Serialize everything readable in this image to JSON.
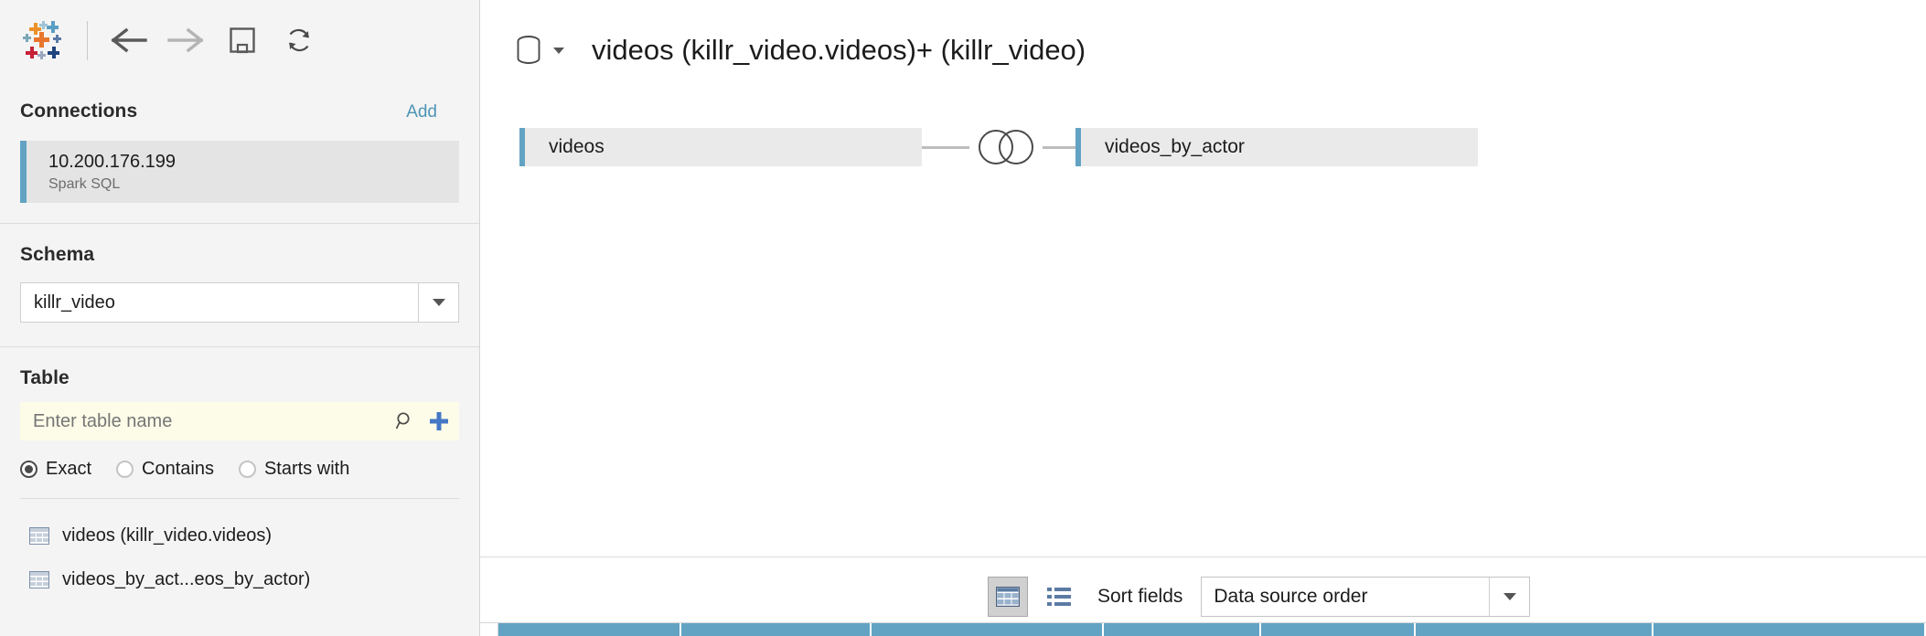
{
  "toolbar": {
    "logo_name": "tableau-logo",
    "back_label": "Back",
    "forward_label": "Forward",
    "save_label": "Save",
    "refresh_label": "Refresh Data Source"
  },
  "sidebar": {
    "connections": {
      "heading": "Connections",
      "add_label": "Add",
      "items": [
        {
          "name": "10.200.176.199",
          "type": "Spark SQL",
          "selected": true
        }
      ]
    },
    "schema": {
      "heading": "Schema",
      "selected": "killr_video"
    },
    "table": {
      "heading": "Table",
      "search_placeholder": "Enter table name",
      "search_value": "",
      "search_icon": "search-icon",
      "add_icon": "plus-icon",
      "match_options": [
        {
          "label": "Exact",
          "selected": true
        },
        {
          "label": "Contains",
          "selected": false
        },
        {
          "label": "Starts with",
          "selected": false
        }
      ],
      "tables": [
        {
          "label": "videos (killr_video.videos)"
        },
        {
          "label": "videos_by_act...eos_by_actor)"
        }
      ]
    }
  },
  "canvas": {
    "db_icon": "database-icon",
    "title": "videos (killr_video.videos)+ (killr_video)",
    "join": {
      "left_table": "videos",
      "right_table": "videos_by_actor",
      "join_type_icon": "inner-join-venn-icon"
    }
  },
  "bottom_toolbar": {
    "grid_view_icon": "grid-view-icon",
    "list_view_icon": "list-view-icon",
    "sort_fields_label": "Sort fields",
    "sort_value": "Data source order"
  },
  "colors": {
    "accent_blue": "#62a3c4",
    "link_blue": "#4e95b6",
    "panel_gray": "#f4f4f4",
    "row_gray": "#eaeaea",
    "search_yellow": "#fcfce8",
    "plus_blue": "#4477c4",
    "grid_header_blue": "#62a3c4"
  }
}
